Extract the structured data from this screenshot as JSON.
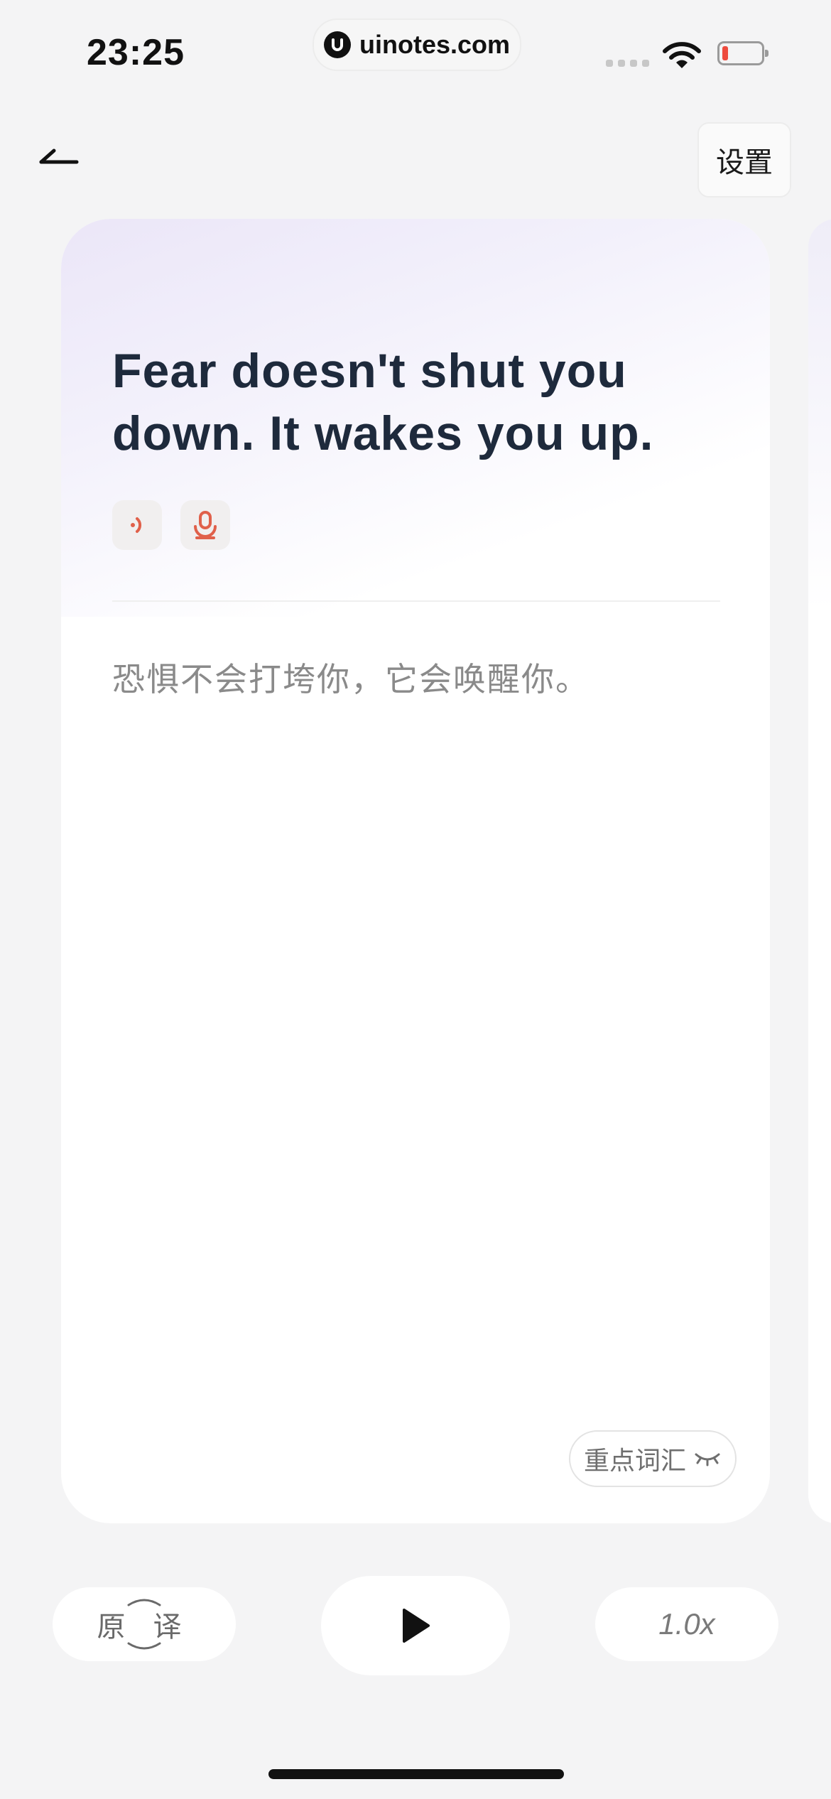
{
  "status_bar": {
    "time": "23:25",
    "url": "uinotes.com",
    "battery_level": 0.15,
    "battery_color": "#ee4b3e"
  },
  "header": {
    "back_icon": "back-arrow-icon",
    "settings_label": "设置"
  },
  "card": {
    "sentence": "Fear doesn't shut you down. It wakes you up.",
    "translation": "恐惧不会打垮你，它会唤醒你。",
    "play_audio_icon": "speaker-icon",
    "record_icon": "microphone-icon",
    "accent_color": "#e0604a",
    "vocab_label": "重点词汇",
    "vocab_icon": "eye-closed-icon"
  },
  "controls": {
    "original_translation_label": "原 译",
    "play_icon": "play-icon",
    "speed_label": "1.0x"
  }
}
